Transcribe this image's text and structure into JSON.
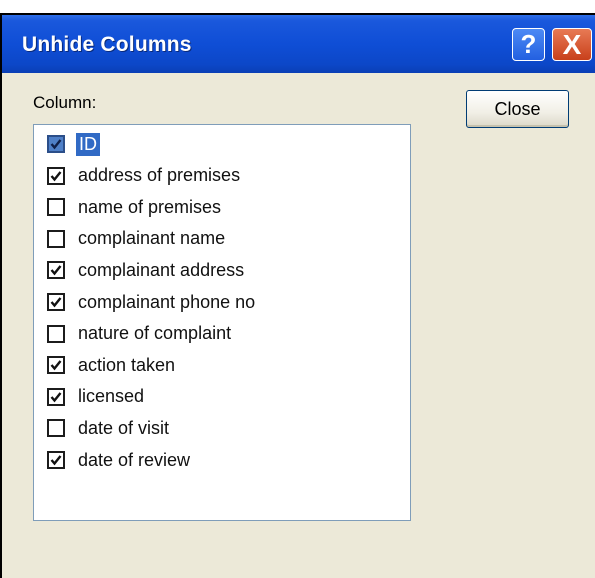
{
  "window": {
    "title": "Unhide Columns",
    "help_symbol": "?",
    "close_symbol": "X"
  },
  "dialog": {
    "column_label": "Column:",
    "close_button_label": "Close"
  },
  "columns": [
    {
      "label": "ID",
      "checked": true,
      "selected": true
    },
    {
      "label": "address of premises",
      "checked": true,
      "selected": false
    },
    {
      "label": "name of premises",
      "checked": false,
      "selected": false
    },
    {
      "label": "complainant name",
      "checked": false,
      "selected": false
    },
    {
      "label": "complainant address",
      "checked": true,
      "selected": false
    },
    {
      "label": "complainant phone no",
      "checked": true,
      "selected": false
    },
    {
      "label": "nature of complaint",
      "checked": false,
      "selected": false
    },
    {
      "label": "action taken",
      "checked": true,
      "selected": false
    },
    {
      "label": "licensed",
      "checked": true,
      "selected": false
    },
    {
      "label": "date of visit",
      "checked": false,
      "selected": false
    },
    {
      "label": "date of review",
      "checked": true,
      "selected": false
    }
  ],
  "colors": {
    "titlebar": "#0f4ed6",
    "selection": "#316ac5",
    "dialog_bg": "#ece9d8"
  }
}
